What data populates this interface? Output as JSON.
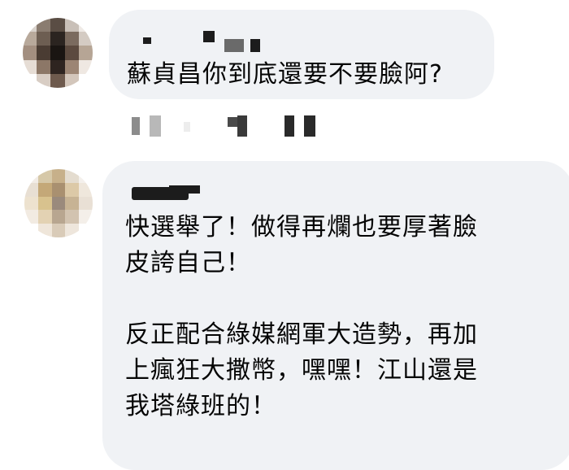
{
  "comments": [
    {
      "avatar": "pixelated-avatar",
      "author_name": "",
      "text": "蘇貞昌你到底還要不要臉阿?"
    },
    {
      "avatar": "pixelated-avatar",
      "author_name": "",
      "text": "快選舉了！做得再爛也要厚著臉\n皮誇自己！\n\n反正配合綠媒網軍大造勢，再加\n上瘋狂大撒幣，嘿嘿！江山還是\n我塔綠班的！"
    }
  ],
  "colors": {
    "bubble": "#f0f2f5",
    "text": "#050505",
    "redaction": "#1c1c1c"
  }
}
